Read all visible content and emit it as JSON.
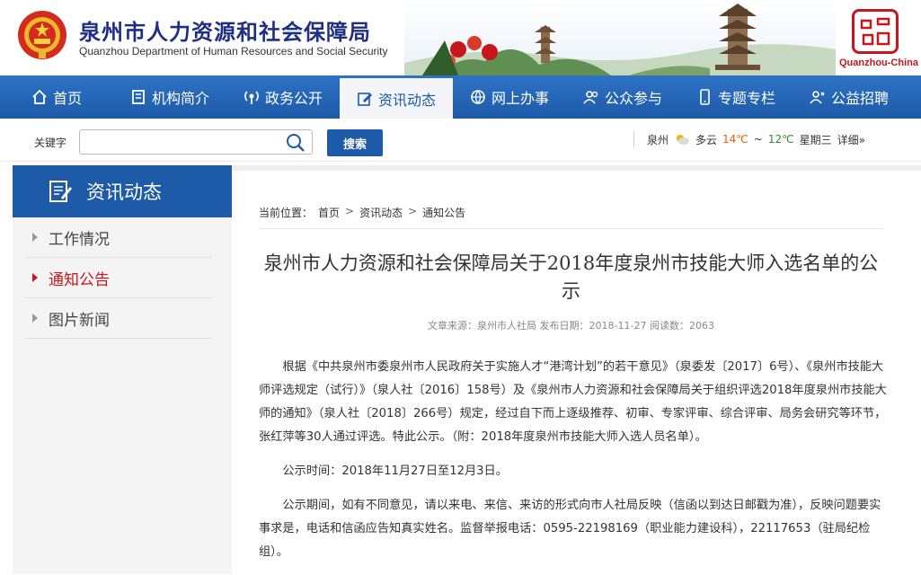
{
  "header": {
    "title": "泉州市人力资源和社会保障局",
    "subtitle": "Quanzhou Department of Human Resources and Social Security",
    "seal_caption": "Quanzhou-China"
  },
  "nav": {
    "items": [
      {
        "label": "首页",
        "icon": "home-icon"
      },
      {
        "label": "机构简介",
        "icon": "building-icon"
      },
      {
        "label": "政务公开",
        "icon": "broadcast-icon"
      },
      {
        "label": "资讯动态",
        "icon": "edit-icon",
        "active": true
      },
      {
        "label": "网上办事",
        "icon": "globe-icon"
      },
      {
        "label": "公众参与",
        "icon": "people-icon"
      },
      {
        "label": "专题专栏",
        "icon": "phone-icon"
      },
      {
        "label": "公益招聘",
        "icon": "recruit-icon"
      }
    ]
  },
  "search": {
    "label": "关键字",
    "value": "",
    "button": "搜索"
  },
  "weather": {
    "city": "泉州",
    "condition": "多云",
    "high": "14℃",
    "tilde": "~",
    "low": "12℃",
    "weekday": "星期三",
    "more": "详细»"
  },
  "sidebar": {
    "title": "资讯动态",
    "items": [
      {
        "label": "工作情况"
      },
      {
        "label": "通知公告",
        "active": true
      },
      {
        "label": "图片新闻"
      }
    ]
  },
  "breadcrumb": {
    "prefix": "当前位置：",
    "items": [
      "首页",
      "资讯动态",
      "通知公告"
    ],
    "separator": ">"
  },
  "article": {
    "title": "泉州市人力资源和社会保障局关于2018年度泉州市技能大师入选名单的公示",
    "meta": "文章来源：泉州市人社局    发布日期：2018-11-27  阅读数：2063",
    "paragraphs": [
      "根据《中共泉州市委泉州市人民政府关于实施人才“港湾计划”的若干意见》（泉委发〔2017〕6号）、《泉州市技能大师评选规定（试行）》（泉人社〔2016〕158号）及《泉州市人力资源和社会保障局关于组织评选2018年度泉州市技能大师的通知》（泉人社〔2018〕266号）规定，经过自下而上逐级推荐、初审、专家评审、综合评审、局务会研究等环节，张红萍等30人通过评选。特此公示。（附：2018年度泉州市技能大师入选人员名单）。",
      "公示时间：2018年11月27日至12月3日。",
      "公示期间，如有不同意见，请以来电、来信、来访的形式向市人社局反映（信函以到达日邮戳为准），反映问题要实事求是，电话和信函应告知真实姓名。监督举报电话：0595-22198169（职业能力建设科），22117653（驻局纪检组）。"
    ]
  },
  "colors": {
    "brand_blue": "#1d5aa8",
    "title_blue": "#1f2f86",
    "accent_red": "#c8161d"
  }
}
